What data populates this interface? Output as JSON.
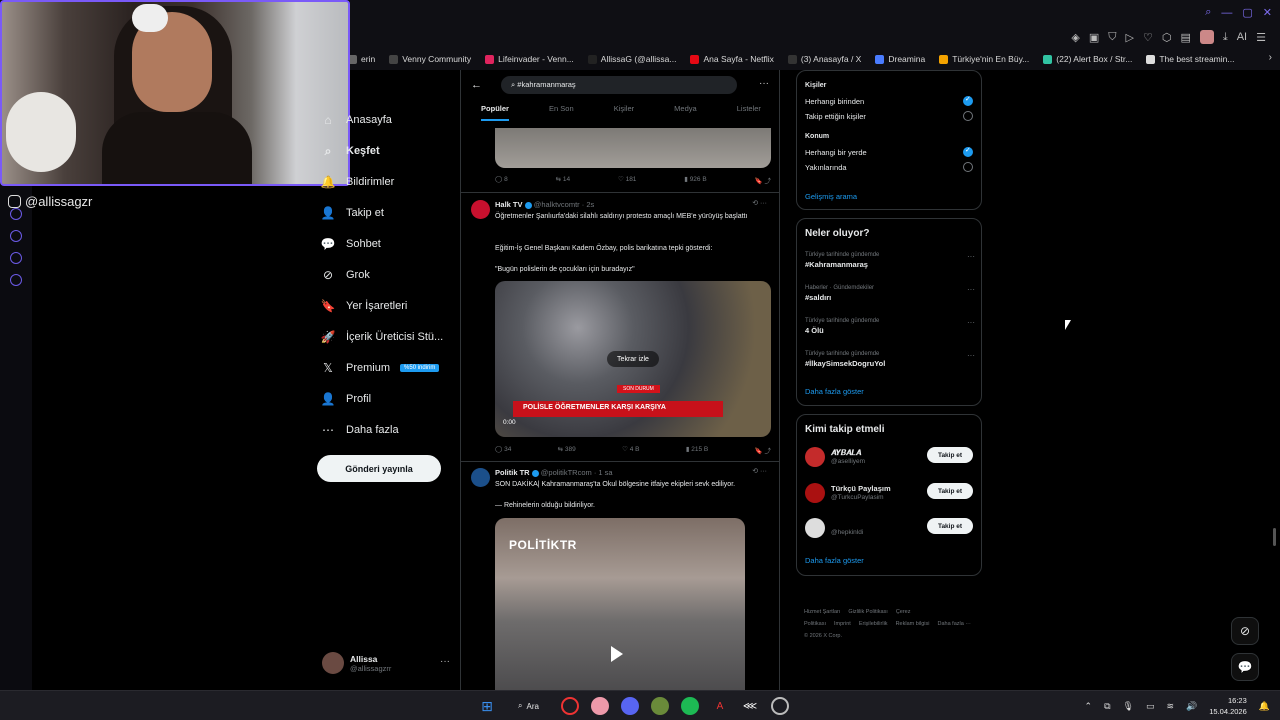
{
  "browser": {
    "bookmarks": [
      {
        "label": "erin",
        "color": "#666"
      },
      {
        "label": "Venny Community",
        "color": "#444"
      },
      {
        "label": "Lifeinvader - Venn...",
        "color": "#e0245e"
      },
      {
        "label": "AllissaG (@allissa...",
        "color": "#222"
      },
      {
        "label": "Ana Sayfa - Netflix",
        "color": "#e50914"
      },
      {
        "label": "(3) Anasayfa / X",
        "color": "#333"
      },
      {
        "label": "Dreamina",
        "color": "#4a7cff"
      },
      {
        "label": "Türkiye'nin En Büy...",
        "color": "#f4a300"
      },
      {
        "label": "(22) Alert Box / Str...",
        "color": "#31c3a2"
      },
      {
        "label": "The best streamin...",
        "color": "#ddd"
      }
    ],
    "ext_ai_label": "AI"
  },
  "stream": {
    "handle": "@allissagzr"
  },
  "nav": {
    "items": [
      {
        "label": "Anasayfa",
        "icon": "home-icon",
        "glyph": "⌂"
      },
      {
        "label": "Keşfet",
        "icon": "search-icon",
        "glyph": "⌕"
      },
      {
        "label": "Bildirimler",
        "icon": "bell-icon",
        "glyph": "🔔"
      },
      {
        "label": "Takip et",
        "icon": "add-person-icon",
        "glyph": "👤"
      },
      {
        "label": "Sohbet",
        "icon": "chat-icon",
        "glyph": "💬"
      },
      {
        "label": "Grok",
        "icon": "grok-icon",
        "glyph": "⊘"
      },
      {
        "label": "Yer İşaretleri",
        "icon": "bookmark-icon",
        "glyph": "🔖"
      },
      {
        "label": "İçerik Üreticisi Stü...",
        "icon": "rocket-icon",
        "glyph": "🚀"
      },
      {
        "label": "Premium",
        "icon": "x-logo-icon",
        "glyph": "𝕏"
      },
      {
        "label": "Profil",
        "icon": "profile-icon",
        "glyph": "👤"
      },
      {
        "label": "Daha fazla",
        "icon": "more-icon",
        "glyph": "⋯"
      }
    ],
    "premium_badge": "%50 indirim",
    "post_button": "Gönderi yayınla",
    "profile_name": "Allissa",
    "profile_handle": "@allissagzrr"
  },
  "feed": {
    "search_value": "#kahramanmaraş",
    "tabs": [
      "Popüler",
      "En Son",
      "Kişiler",
      "Medya",
      "Listeler"
    ],
    "first_actions": [
      "8",
      "14",
      "181",
      "926 B"
    ],
    "tweet1": {
      "name": "Halk TV",
      "handle": "@halktvcomtr · 2s",
      "line1": "Öğretmenler Şanlıurfa'daki silahlı saldırıyı protesto amaçlı MEB'e yürüyüş başlattı",
      "line2": "Eğitim-İş Genel Başkanı Kadem Özbay, polis barikatına tepki gösterdi:",
      "line3": "\"Bugün polislerin de çocukları için buradayız\"",
      "media_banner": "POLİSLE ÖĞRETMENLER KARŞI KARŞIYA",
      "media_tag": "SON DURUM",
      "replay": "Tekrar izle",
      "time": "0:00",
      "actions": [
        "34",
        "389",
        "4 B",
        "215 B"
      ]
    },
    "tweet2": {
      "name": "Politik TR",
      "handle": "@politikTRcom · 1 sa",
      "line1": "SON DAKİKA| Kahramanmaraş'ta Okul bölgesine itfaiye ekipleri sevk ediliyor.",
      "line2": "— Rehinelerin olduğu bildiriliyor.",
      "media_brand": "POLİTİKTR"
    }
  },
  "filters": {
    "people_title": "Kişiler",
    "people_opts": [
      "Herhangi birinden",
      "Takip ettiğin kişiler"
    ],
    "location_title": "Konum",
    "location_opts": [
      "Herhangi bir yerde",
      "Yakınlarında"
    ],
    "advanced": "Gelişmiş arama"
  },
  "trends": {
    "title": "Neler oluyor?",
    "items": [
      {
        "context": "Türkiye tarihinde gündemde",
        "topic": "#Kahramanmaraş"
      },
      {
        "context": "Haberler · Gündemdekiler",
        "topic": "#saldırı"
      },
      {
        "context": "Türkiye tarihinde gündemde",
        "topic": "4 Ölü"
      },
      {
        "context": "Türkiye tarihinde gündemde",
        "topic": "#İlkaySimsekDogruYol"
      }
    ],
    "more": "Daha fazla göster"
  },
  "who": {
    "title": "Kimi takip etmeli",
    "items": [
      {
        "name": "𝑨𝒀𝑩𝑨𝑳𝑨",
        "handle": "@aseIliyem",
        "color": "#c42b2b"
      },
      {
        "name": "Türkçü Paylaşım",
        "handle": "@TurkcuPaylasim",
        "color": "#a11"
      },
      {
        "name": "",
        "handle": "@hepkinldi",
        "color": "#ddd"
      }
    ],
    "follow_label": "Takip et",
    "more": "Daha fazla göster"
  },
  "footer": {
    "links": [
      "Hizmet Şartları",
      "Gizlilik Politikası",
      "Çerez Politikası",
      "Imprint",
      "Erişilebilirlik",
      "Reklam bilgisi",
      "Daha fazla ···"
    ],
    "copyright": "© 2026 X Corp."
  },
  "taskbar": {
    "search": "Ara",
    "time": "16:23",
    "date": "15.04.2026"
  }
}
